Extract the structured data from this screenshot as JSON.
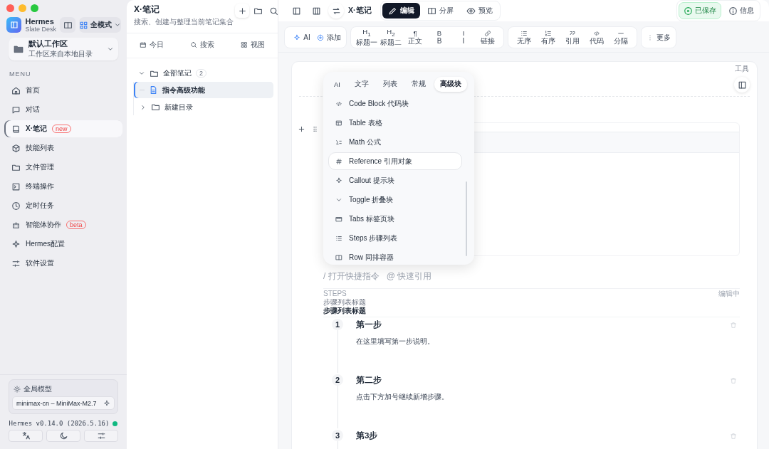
{
  "sidebar": {
    "app_name": "Hermes",
    "app_subtitle": "Slate Desk",
    "mode_button": "全模式",
    "workspace": {
      "name": "默认工作区",
      "description": "工作区来自本地目录"
    },
    "menu_heading": "MENU",
    "items": [
      {
        "label": "首页",
        "selected": false
      },
      {
        "label": "对话",
        "selected": false
      },
      {
        "label": "X·笔记",
        "selected": true,
        "badge": "new"
      },
      {
        "label": "技能列表",
        "selected": false
      },
      {
        "label": "文件管理",
        "selected": false
      },
      {
        "label": "终端操作",
        "selected": false
      },
      {
        "label": "定时任务",
        "selected": false
      },
      {
        "label": "智能体协作",
        "selected": false,
        "badge": "beta"
      },
      {
        "label": "Hermes配置",
        "selected": false
      },
      {
        "label": "软件设置",
        "selected": false
      }
    ],
    "model": {
      "label": "全局模型",
      "value": "minimax-cn – MiniMax-M2.7"
    },
    "version": "Hermes v0.14.0 (2026.5.16)"
  },
  "notes": {
    "title": "X·笔记",
    "subtitle": "搜索、创建与整理当前笔记集合",
    "tabs": [
      {
        "label": "今日"
      },
      {
        "label": "搜索"
      },
      {
        "label": "视图"
      }
    ],
    "tree": [
      {
        "label": "全部笔记",
        "count": "2",
        "expanded": true,
        "selected": false,
        "children": [
          {
            "label": "指令高级功能",
            "kind": "note",
            "selected": true
          },
          {
            "label": "新建目录",
            "kind": "folder",
            "expanded": false,
            "selected": false
          }
        ]
      }
    ]
  },
  "topbar": {
    "title": "X·笔记",
    "modes": [
      {
        "label": "编辑",
        "selected": true
      },
      {
        "label": "分屏",
        "selected": false
      },
      {
        "label": "预览",
        "selected": false
      }
    ],
    "saved": "已保存",
    "info": "信息"
  },
  "toolbar": [
    {
      "items": [
        {
          "label": "AI"
        },
        {
          "label": "添加"
        }
      ]
    },
    {
      "items": [
        {
          "label": "标题一",
          "glyph": "H$_{1}$"
        },
        {
          "label": "标题二",
          "glyph": "H$_{2}$"
        },
        {
          "label": "正文",
          "glyph": "¶"
        },
        {
          "label": "B",
          "glyph": "B"
        },
        {
          "label": "I",
          "glyph": "I"
        },
        {
          "label": "链接"
        }
      ]
    },
    {
      "items": [
        {
          "label": "无序"
        },
        {
          "label": "有序"
        },
        {
          "label": "引用"
        },
        {
          "label": "代码"
        },
        {
          "label": "分隔"
        }
      ]
    },
    {
      "items": [
        {
          "label": "更多"
        }
      ]
    }
  ],
  "editor": {
    "tools_label": "工具",
    "hint_command": "/ 打开快捷指令",
    "hint_reference": "@ 快速引用",
    "steps_block": {
      "label": "STEPS",
      "status": "编辑中",
      "caption": "步骤列表标题",
      "title": "步骤列表标题",
      "steps": [
        {
          "number": "1",
          "title": "第一步",
          "description": "在这里填写第一步说明。"
        },
        {
          "number": "2",
          "title": "第二步",
          "description": "点击下方加号继续新增步骤。"
        },
        {
          "number": "3",
          "title": "第3步"
        }
      ]
    }
  },
  "command_menu": {
    "tabs": [
      {
        "label": "AI",
        "selected": false
      },
      {
        "label": "文字",
        "selected": false
      },
      {
        "label": "列表",
        "selected": false
      },
      {
        "label": "常规",
        "selected": false
      },
      {
        "label": "高级块",
        "selected": true
      }
    ],
    "items": [
      {
        "label": "Code Block 代码块",
        "selected": false
      },
      {
        "label": "Table 表格",
        "selected": false
      },
      {
        "label": "Math 公式",
        "selected": false
      },
      {
        "label": "Reference 引用对象",
        "selected": true
      },
      {
        "label": "Callout 提示块",
        "selected": false
      },
      {
        "label": "Toggle 折叠块",
        "selected": false
      },
      {
        "label": "Tabs 标签页块",
        "selected": false
      },
      {
        "label": "Steps 步骤列表",
        "selected": false
      },
      {
        "label": "Row 同排容器",
        "selected": false
      }
    ]
  }
}
